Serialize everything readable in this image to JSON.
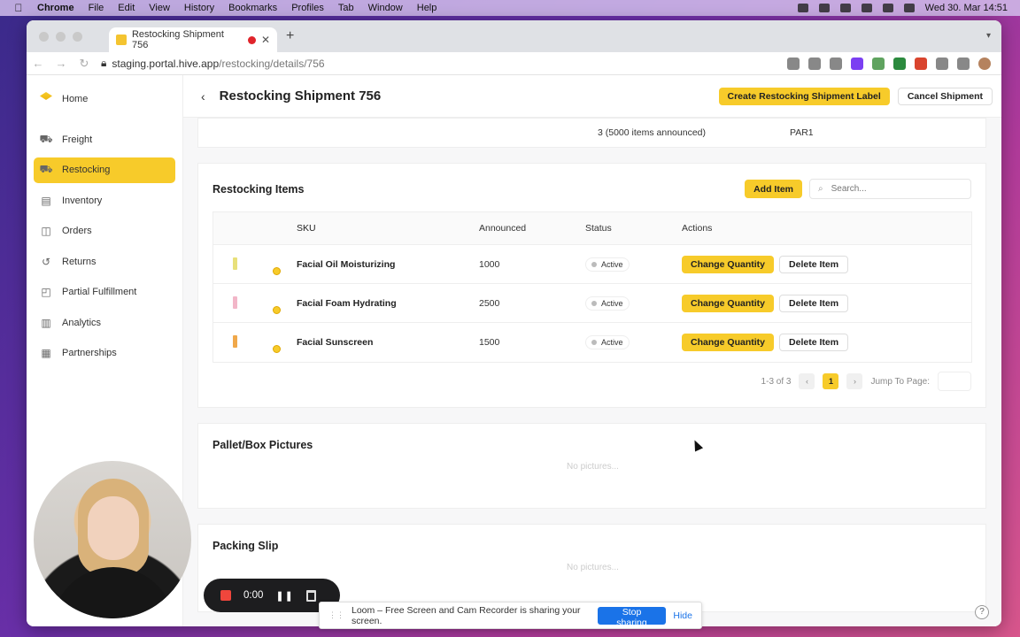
{
  "os_menubar": {
    "app": "Chrome",
    "items": [
      "File",
      "Edit",
      "View",
      "History",
      "Bookmarks",
      "Profiles",
      "Tab",
      "Window",
      "Help"
    ],
    "clock": "Wed 30. Mar  14:51"
  },
  "browser": {
    "tab_title": "Restocking Shipment 756",
    "url_domain": "staging.portal.hive.app",
    "url_path": "/restocking/details/756"
  },
  "sidebar": {
    "items": [
      {
        "label": "Home",
        "icon": "hive-logo-icon"
      },
      {
        "label": "Freight",
        "icon": "freight-icon"
      },
      {
        "label": "Restocking",
        "icon": "truck-icon",
        "active": true
      },
      {
        "label": "Inventory",
        "icon": "clipboard-icon"
      },
      {
        "label": "Orders",
        "icon": "bag-icon"
      },
      {
        "label": "Returns",
        "icon": "return-icon"
      },
      {
        "label": "Partial Fulfillment",
        "icon": "box-icon"
      },
      {
        "label": "Analytics",
        "icon": "chart-icon"
      },
      {
        "label": "Partnerships",
        "icon": "gift-icon"
      }
    ]
  },
  "header": {
    "title": "Restocking Shipment 756",
    "create_label": "Create Restocking Shipment Label",
    "cancel_label": "Cancel Shipment"
  },
  "summary": {
    "items_announced": "3 (5000 items announced)",
    "warehouse": "PAR1"
  },
  "restocking_items": {
    "heading": "Restocking Items",
    "add_label": "Add Item",
    "search_placeholder": "Search...",
    "columns": [
      "SKU",
      "Announced",
      "Status",
      "Actions"
    ],
    "rows": [
      {
        "sku": "Facial Oil Moisturizing",
        "announced": "1000",
        "status": "Active",
        "color": "#e8e07a"
      },
      {
        "sku": "Facial Foam Hydrating",
        "announced": "2500",
        "status": "Active",
        "color": "#f2b6c8"
      },
      {
        "sku": "Facial Sunscreen",
        "announced": "1500",
        "status": "Active",
        "color": "#f0a84a"
      }
    ],
    "change_label": "Change Quantity",
    "delete_label": "Delete Item",
    "pager": {
      "range": "1-3 of 3",
      "current": "1",
      "jump_label": "Jump To Page:"
    }
  },
  "pallet": {
    "heading": "Pallet/Box Pictures",
    "empty": "No pictures..."
  },
  "slip": {
    "heading": "Packing Slip",
    "empty": "No pictures..."
  },
  "recorder": {
    "time": "0:00"
  },
  "share": {
    "message": "Loom – Free Screen and Cam Recorder is sharing your screen.",
    "stop_label": "Stop sharing",
    "hide_label": "Hide"
  },
  "colors": {
    "accent": "#f7cb2a",
    "link": "#1a73e8"
  }
}
